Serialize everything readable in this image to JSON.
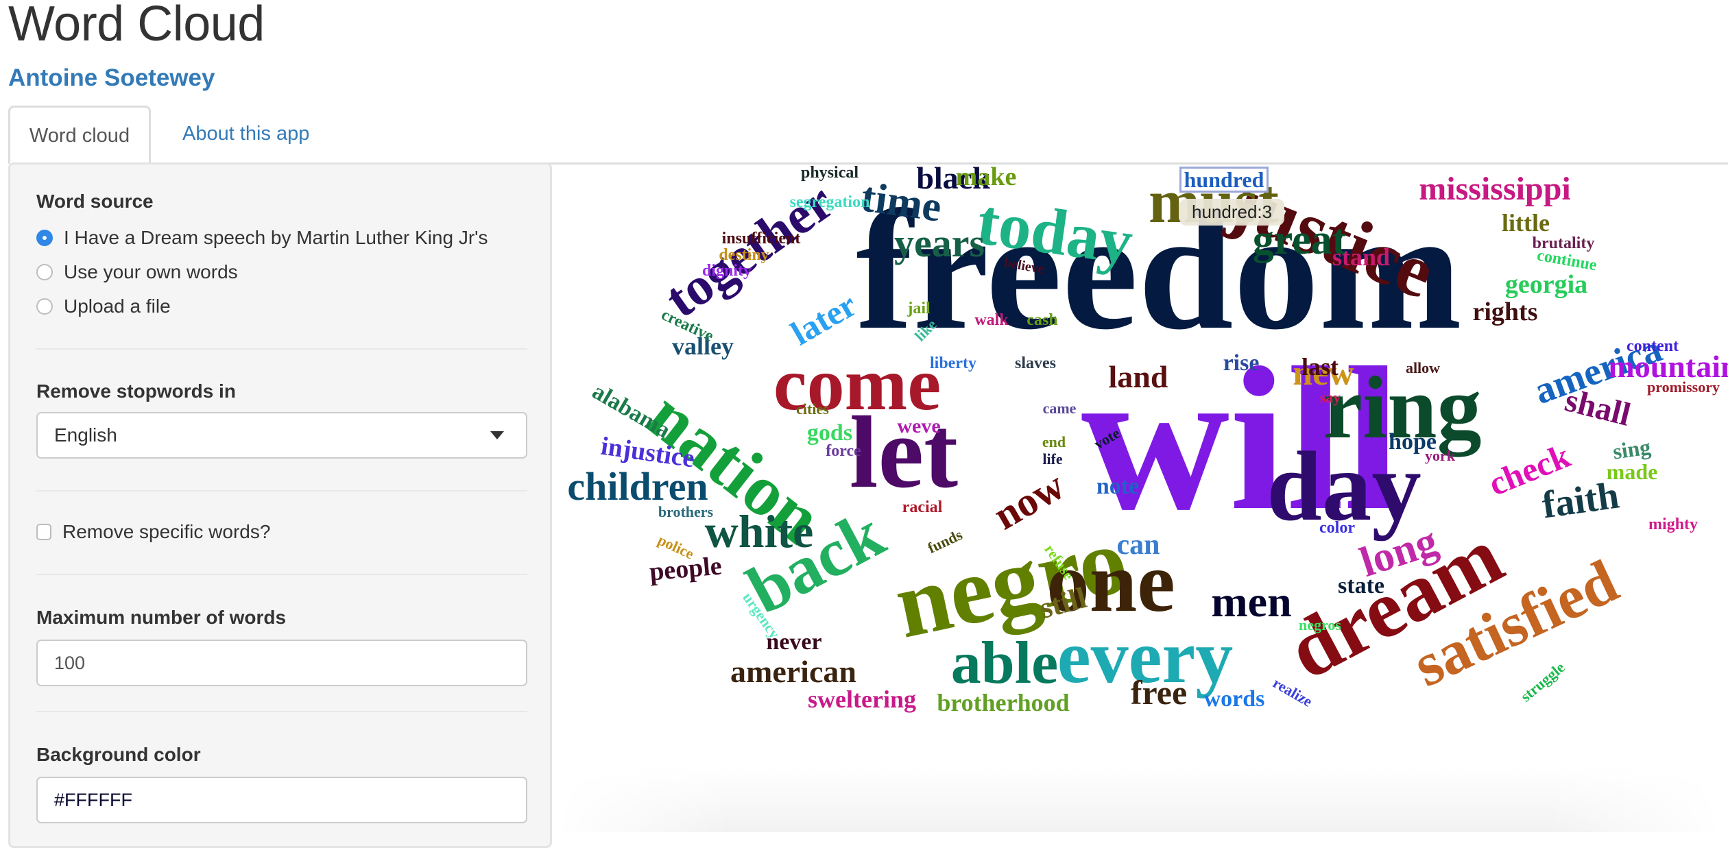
{
  "header": {
    "title": "Word Cloud",
    "author": "Antoine Soetewey"
  },
  "tabs": [
    {
      "label": "Word cloud",
      "active": true
    },
    {
      "label": "About this app",
      "active": false
    }
  ],
  "sidebar": {
    "word_source": {
      "label": "Word source",
      "options": [
        {
          "label": "I Have a Dream speech by Martin Luther King Jr's",
          "checked": true
        },
        {
          "label": "Use your own words",
          "checked": false
        },
        {
          "label": "Upload a file",
          "checked": false
        }
      ]
    },
    "stopwords": {
      "label": "Remove stopwords in",
      "selected": "English"
    },
    "remove_specific": {
      "label": "Remove specific words?",
      "checked": false
    },
    "max_words": {
      "label": "Maximum number of words",
      "value": "100"
    },
    "background_color": {
      "label": "Background color",
      "value": "#FFFFFF"
    }
  },
  "wordcloud": {
    "hovered_word": "hundred",
    "tooltip": "hundred:3",
    "words": [
      {
        "text": "will",
        "color": "#7f1ae5"
      },
      {
        "text": "freedom",
        "color": "#041a40"
      },
      {
        "text": "ring",
        "color": "#0b4a2b"
      },
      {
        "text": "day",
        "color": "#2e0b6d"
      },
      {
        "text": "dream",
        "color": "#850c12"
      },
      {
        "text": "negro",
        "color": "#628000"
      },
      {
        "text": "one",
        "color": "#3d2308"
      },
      {
        "text": "let",
        "color": "#4d0a66"
      },
      {
        "text": "every",
        "color": "#1eaab3"
      },
      {
        "text": "justice",
        "color": "#540b0f"
      },
      {
        "text": "nation",
        "color": "#13a03a"
      },
      {
        "text": "come",
        "color": "#a8182b"
      },
      {
        "text": "back",
        "color": "#22b060"
      },
      {
        "text": "today",
        "color": "#1db386"
      },
      {
        "text": "must",
        "color": "#636210"
      },
      {
        "text": "satisfied",
        "color": "#c46522"
      },
      {
        "text": "together",
        "color": "#2a0a6b"
      },
      {
        "text": "able",
        "color": "#077a5e"
      },
      {
        "text": "men",
        "color": "#04042e"
      },
      {
        "text": "white",
        "color": "#0f5444"
      },
      {
        "text": "children",
        "color": "#0a4c6e"
      },
      {
        "text": "great",
        "color": "#07502e"
      },
      {
        "text": "time",
        "color": "#0f3a60"
      },
      {
        "text": "years",
        "color": "#166048"
      },
      {
        "text": "america",
        "color": "#1565c0"
      },
      {
        "text": "long",
        "color": "#c02aa8"
      },
      {
        "text": "mississippi",
        "color": "#c81882"
      },
      {
        "text": "now",
        "color": "#6b0808"
      },
      {
        "text": "faith",
        "color": "#143c48"
      },
      {
        "text": "check",
        "color": "#e010b8"
      },
      {
        "text": "mountain",
        "color": "#b010e0"
      },
      {
        "text": "shall",
        "color": "#7a0a6e"
      },
      {
        "text": "black",
        "color": "#080c40"
      },
      {
        "text": "american",
        "color": "#3a2410"
      },
      {
        "text": "free",
        "color": "#3a2410"
      },
      {
        "text": "new",
        "color": "#cc9418"
      },
      {
        "text": "land",
        "color": "#5a1010"
      },
      {
        "text": "still",
        "color": "#6a6418"
      },
      {
        "text": "can",
        "color": "#3a7ed0"
      },
      {
        "text": "people",
        "color": "#3e0a28"
      },
      {
        "text": "later",
        "color": "#2aa0f0"
      },
      {
        "text": "hundred",
        "color": "#1c5ebf"
      },
      {
        "text": "make",
        "color": "#6a9a10"
      },
      {
        "text": "rights",
        "color": "#401010"
      },
      {
        "text": "brotherhood",
        "color": "#62a024"
      },
      {
        "text": "sweltering",
        "color": "#c81a8a"
      },
      {
        "text": "alabama",
        "color": "#1a7a4a"
      },
      {
        "text": "injustice",
        "color": "#4a30d8"
      },
      {
        "text": "valley",
        "color": "#1a5070"
      },
      {
        "text": "georgia",
        "color": "#26cc5a"
      },
      {
        "text": "stand",
        "color": "#c81a6e"
      },
      {
        "text": "little",
        "color": "#6a6a10"
      },
      {
        "text": "last",
        "color": "#4a0c10"
      },
      {
        "text": "rise",
        "color": "#2a4aa0"
      },
      {
        "text": "hope",
        "color": "#0a3a6a"
      },
      {
        "text": "note",
        "color": "#1e62c8"
      },
      {
        "text": "state",
        "color": "#0a1e3a"
      },
      {
        "text": "never",
        "color": "#3a0a1e"
      },
      {
        "text": "words",
        "color": "#1a78e8"
      },
      {
        "text": "made",
        "color": "#7ac81a"
      },
      {
        "text": "sing",
        "color": "#3a8a6a"
      },
      {
        "text": "gods",
        "color": "#3ad860"
      },
      {
        "text": "weve",
        "color": "#b01ab0"
      },
      {
        "text": "physical",
        "color": "#1a2a2a"
      },
      {
        "text": "segregation",
        "color": "#3adac0"
      },
      {
        "text": "insufficient",
        "color": "#4a0a10"
      },
      {
        "text": "destiny",
        "color": "#c89018"
      },
      {
        "text": "dignity",
        "color": "#9a2ae8"
      },
      {
        "text": "creative",
        "color": "#1a7a4a"
      },
      {
        "text": "believe",
        "color": "#4a0a20"
      },
      {
        "text": "brutality",
        "color": "#6a2050"
      },
      {
        "text": "continue",
        "color": "#26d860"
      },
      {
        "text": "jail",
        "color": "#6aa010"
      },
      {
        "text": "like",
        "color": "#3ab89a"
      },
      {
        "text": "walk",
        "color": "#c01a78"
      },
      {
        "text": "cash",
        "color": "#6aa010"
      },
      {
        "text": "liberty",
        "color": "#2a70d8"
      },
      {
        "text": "slaves",
        "color": "#2a3a4a"
      },
      {
        "text": "content",
        "color": "#4020e0"
      },
      {
        "text": "allow",
        "color": "#4a1a1a"
      },
      {
        "text": "promissory",
        "color": "#a01a2a"
      },
      {
        "text": "cities",
        "color": "#6a6a10"
      },
      {
        "text": "force",
        "color": "#6a3a9a"
      },
      {
        "text": "came",
        "color": "#5a4a9a"
      },
      {
        "text": "say",
        "color": "#d81a5a"
      },
      {
        "text": "end",
        "color": "#6a8a10"
      },
      {
        "text": "life",
        "color": "#1a1a4a"
      },
      {
        "text": "vote",
        "color": "#0a1a2a"
      },
      {
        "text": "york",
        "color": "#9a1a7a"
      },
      {
        "text": "racial",
        "color": "#b01a2a"
      },
      {
        "text": "brothers",
        "color": "#2a6a7a"
      },
      {
        "text": "color",
        "color": "#3a30e0"
      },
      {
        "text": "mighty",
        "color": "#d01a8a"
      },
      {
        "text": "police",
        "color": "#c8901a"
      },
      {
        "text": "funds",
        "color": "#4a4a10"
      },
      {
        "text": "refuse",
        "color": "#7ad81a"
      },
      {
        "text": "negros",
        "color": "#3ae060"
      },
      {
        "text": "urgency",
        "color": "#5ae8c0"
      },
      {
        "text": "realize",
        "color": "#3a40d8"
      },
      {
        "text": "struggle",
        "color": "#1ab84a"
      }
    ]
  }
}
